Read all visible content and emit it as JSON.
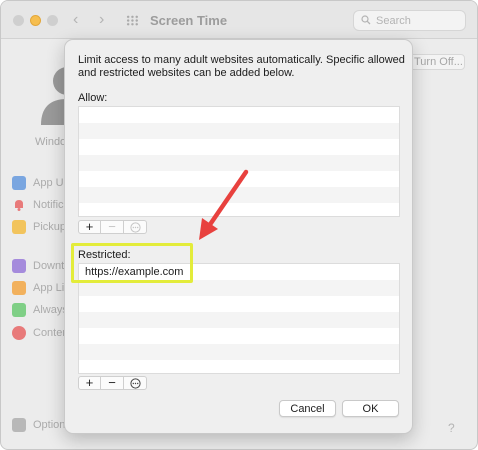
{
  "window": {
    "title": "Screen Time",
    "search_placeholder": "Search",
    "user_name": "Windo",
    "turn_off_label": "Turn Off...",
    "help_label": "?"
  },
  "sidebar": {
    "items": [
      {
        "label": "App Us",
        "icon": "app-usage-icon",
        "color": "#7aa6e0"
      },
      {
        "label": "Notific",
        "icon": "notifications-icon",
        "color": "#e87a7a"
      },
      {
        "label": "Pickup",
        "icon": "pickups-icon",
        "color": "#f2c45d"
      },
      {
        "label": "Downti",
        "icon": "downtime-icon",
        "color": "#a58bdc"
      },
      {
        "label": "App Li",
        "icon": "app-limits-icon",
        "color": "#f2b15d"
      },
      {
        "label": "Always",
        "icon": "always-allowed-icon",
        "color": "#7fcf86"
      },
      {
        "label": "Conten",
        "icon": "content-privacy-icon",
        "color": "#e87a7a"
      }
    ],
    "options_label": "Option"
  },
  "sheet": {
    "description": "Limit access to many adult websites automatically. Specific allowed and restricted websites can be added below.",
    "allow_label": "Allow:",
    "allow_items": [],
    "restricted_label": "Restricted:",
    "restricted_items": [
      "https://example.com"
    ],
    "add_symbol": "+",
    "remove_symbol": "−",
    "cancel_label": "Cancel",
    "ok_label": "OK"
  },
  "annotations": {
    "arrow_color": "#e8413e",
    "highlight_color": "#e3ec3a"
  }
}
